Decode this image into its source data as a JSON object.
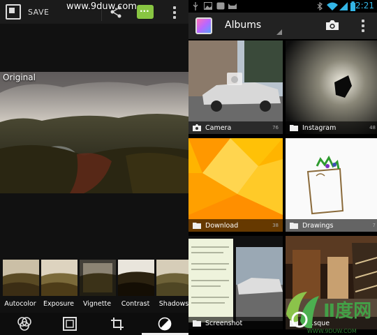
{
  "editor": {
    "save_label": "SAVE",
    "watermark": "www.9duw.com",
    "original_label": "Original",
    "filters": [
      {
        "label": "Autocolor"
      },
      {
        "label": "Exposure"
      },
      {
        "label": "Vignette"
      },
      {
        "label": "Contrast"
      },
      {
        "label": "Shadows"
      }
    ],
    "tools": [
      "filters-icon",
      "frame-icon",
      "crop-icon",
      "adjust-icon"
    ]
  },
  "gallery": {
    "status_time": "2:21",
    "title": "Albums",
    "accent": "#33b5e5",
    "albums": [
      {
        "label": "Camera",
        "count": "76"
      },
      {
        "label": "Instagram",
        "count": "48"
      },
      {
        "label": "Download",
        "count": "38"
      },
      {
        "label": "Drawings",
        "count": "7"
      },
      {
        "label": "Screenshot",
        "count": ""
      },
      {
        "label": "Ir…sque",
        "count": ""
      }
    ],
    "logo_text": "WWW.9DUW.COM"
  }
}
